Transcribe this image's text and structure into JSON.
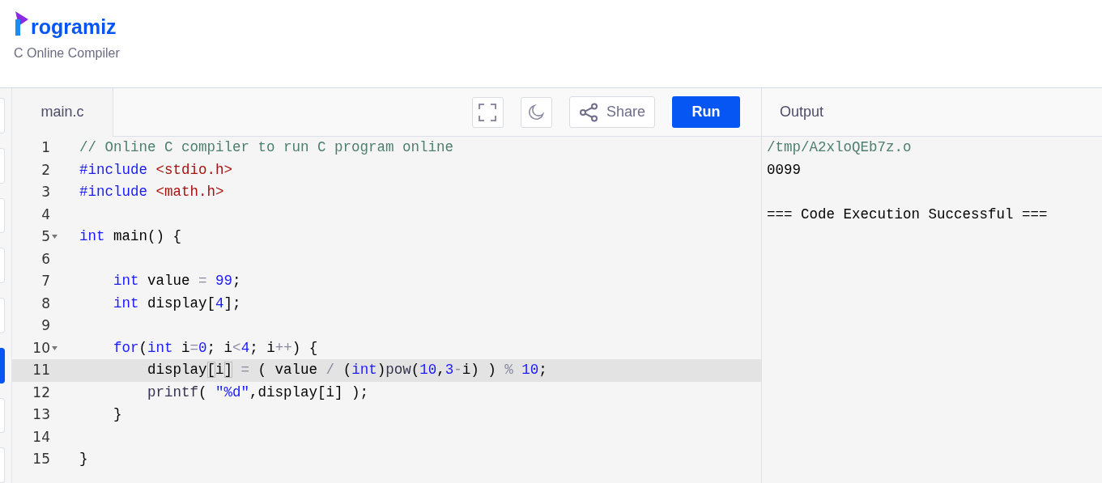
{
  "header": {
    "logo_text": "rogramiz",
    "subtitle": "C Online Compiler"
  },
  "sidebar": {
    "items": [
      {
        "selected": false
      },
      {
        "selected": false
      },
      {
        "selected": false
      },
      {
        "selected": false
      },
      {
        "selected": false
      },
      {
        "selected": true
      },
      {
        "selected": false
      },
      {
        "selected": false
      }
    ]
  },
  "editor": {
    "tabs": [
      {
        "label": "main.c",
        "selected": true
      }
    ],
    "toolbar": {
      "share_label": "Share",
      "run_label": "Run"
    },
    "lines": [
      {
        "number": "1",
        "foldable": false,
        "active": false,
        "tokens": [
          {
            "kind": "comment",
            "text": "// Online C compiler to run C program online"
          }
        ]
      },
      {
        "number": "2",
        "foldable": false,
        "active": false,
        "tokens": [
          {
            "kind": "keyword",
            "text": "#include "
          },
          {
            "kind": "string2",
            "text": "<stdio.h>"
          }
        ]
      },
      {
        "number": "3",
        "foldable": false,
        "active": false,
        "tokens": [
          {
            "kind": "keyword",
            "text": "#include "
          },
          {
            "kind": "string2",
            "text": "<math.h>"
          }
        ]
      },
      {
        "number": "4",
        "foldable": false,
        "active": false
      },
      {
        "number": "5",
        "foldable": true,
        "active": false,
        "tokens": [
          {
            "kind": "keyword",
            "text": "int"
          },
          {
            "kind": "plain",
            "text": " main() {"
          }
        ]
      },
      {
        "number": "6",
        "foldable": false,
        "active": false
      },
      {
        "number": "7",
        "foldable": false,
        "active": false,
        "tokens": [
          {
            "kind": "keyword",
            "text": "    int"
          },
          {
            "kind": "plain",
            "text": " value "
          },
          {
            "kind": "operator",
            "text": "="
          },
          {
            "kind": "number",
            "text": " 99"
          },
          {
            "kind": "plain",
            "text": ";"
          }
        ]
      },
      {
        "number": "8",
        "foldable": false,
        "active": false,
        "tokens": [
          {
            "kind": "keyword",
            "text": "    int"
          },
          {
            "kind": "plain",
            "text": " display["
          },
          {
            "kind": "number",
            "text": "4"
          },
          {
            "kind": "plain",
            "text": "];"
          }
        ]
      },
      {
        "number": "9",
        "foldable": false,
        "active": false
      },
      {
        "number": "10",
        "foldable": true,
        "active": false,
        "tokens": [
          {
            "kind": "keyword",
            "text": "    for"
          },
          {
            "kind": "plain",
            "text": "("
          },
          {
            "kind": "keyword",
            "text": "int"
          },
          {
            "kind": "plain",
            "text": " i"
          },
          {
            "kind": "operator",
            "text": "="
          },
          {
            "kind": "number",
            "text": "0"
          },
          {
            "kind": "plain",
            "text": "; i"
          },
          {
            "kind": "operator",
            "text": "<"
          },
          {
            "kind": "number",
            "text": "4"
          },
          {
            "kind": "plain",
            "text": "; i"
          },
          {
            "kind": "operator",
            "text": "++"
          },
          {
            "kind": "plain",
            "text": ") {"
          }
        ]
      },
      {
        "number": "11",
        "foldable": false,
        "active": true,
        "tokens": [
          {
            "kind": "plain",
            "text": "        display"
          },
          {
            "kind": "bracket",
            "text": "["
          },
          {
            "kind": "plain",
            "text": "i"
          },
          {
            "kind": "bracket",
            "text": "]"
          },
          {
            "kind": "operator",
            "text": " ="
          },
          {
            "kind": "plain",
            "text": " ( value "
          },
          {
            "kind": "operator",
            "text": "/"
          },
          {
            "kind": "plain",
            "text": " ("
          },
          {
            "kind": "keyword",
            "text": "int"
          },
          {
            "kind": "plain",
            "text": ")"
          },
          {
            "kind": "builtin",
            "text": "pow"
          },
          {
            "kind": "plain",
            "text": "("
          },
          {
            "kind": "number",
            "text": "10"
          },
          {
            "kind": "plain",
            "text": ","
          },
          {
            "kind": "number",
            "text": "3"
          },
          {
            "kind": "operator",
            "text": "-"
          },
          {
            "kind": "plain",
            "text": "i) ) "
          },
          {
            "kind": "operator",
            "text": "%"
          },
          {
            "kind": "number",
            "text": " 10"
          },
          {
            "kind": "plain",
            "text": ";"
          }
        ]
      },
      {
        "number": "12",
        "foldable": false,
        "active": false,
        "tokens": [
          {
            "kind": "builtin",
            "text": "        printf"
          },
          {
            "kind": "plain",
            "text": "( "
          },
          {
            "kind": "string",
            "text": "\""
          },
          {
            "kind": "number",
            "text": "%d"
          },
          {
            "kind": "string",
            "text": "\""
          },
          {
            "kind": "plain",
            "text": ",display[i] );"
          }
        ]
      },
      {
        "number": "13",
        "foldable": false,
        "active": false,
        "tokens": [
          {
            "kind": "plain",
            "text": "    }"
          }
        ]
      },
      {
        "number": "14",
        "foldable": false,
        "active": false
      },
      {
        "number": "15",
        "foldable": false,
        "active": false,
        "tokens": [
          {
            "kind": "plain",
            "text": "}"
          }
        ]
      }
    ]
  },
  "output": {
    "title": "Output",
    "lines": [
      {
        "kind": "path",
        "text": "/tmp/A2xloQEb7z.o"
      },
      {
        "kind": "plain",
        "text": "0099"
      },
      {
        "kind": "blank"
      },
      {
        "kind": "plain",
        "text": "=== Code Execution Successful ==="
      }
    ]
  }
}
